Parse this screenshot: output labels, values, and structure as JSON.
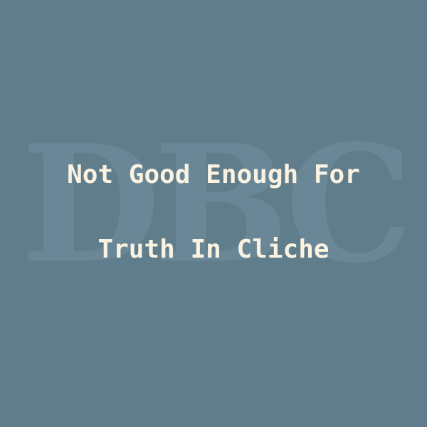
{
  "watermark": "DBC",
  "title": {
    "line1": "Not Good Enough For",
    "line2": "Truth In Cliche"
  },
  "colors": {
    "background": "#607d8b",
    "text": "#fbf3e2",
    "watermark": "#6a8797"
  }
}
